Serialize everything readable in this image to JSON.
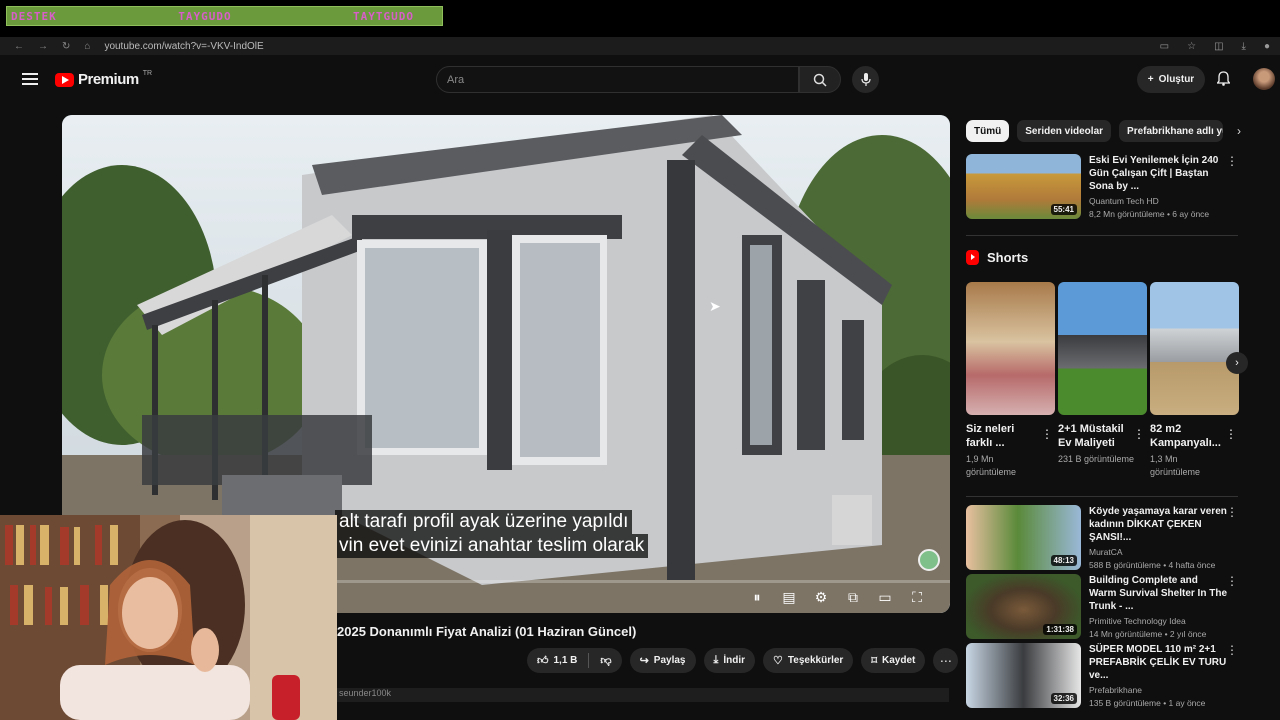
{
  "stream_overlay": {
    "left": "DESTEK",
    "middle": "TAYGUDO",
    "right": "TAYTGUDO"
  },
  "browser": {
    "url": "youtube.com/watch?v=-VKV-IndOlE"
  },
  "masthead": {
    "logo_text": "Premium",
    "logo_region": "TR",
    "search_placeholder": "Ara",
    "create_label": "Oluştur"
  },
  "player": {
    "subtitle_line1": "alt tarafı profil ayak üzerine yapıldı",
    "subtitle_line2": "vin evet evinizi anahtar teslim olarak",
    "progress": 0.0
  },
  "video": {
    "title": "2025 Donanımlı Fiyat Analizi (01 Haziran Güncel)",
    "like_count": "1,1 B",
    "share_label": "Paylaş",
    "download_label": "İndir",
    "thanks_label": "Teşekkürler",
    "save_label": "Kaydet",
    "description_fragment": "seunder100k"
  },
  "chips": [
    "Tümü",
    "Seriden videolar",
    "Prefabrikhane adlı yü"
  ],
  "recommendations_top": [
    {
      "title": "Eski Evi Yenilemek İçin 240 Gün Çalışan Çift | Baştan Sona by ...",
      "channel": "Quantum Tech HD",
      "stats": "8,2 Mn görüntüleme • 6 ay önce",
      "duration": "55:41"
    }
  ],
  "shorts": {
    "heading": "Shorts",
    "items": [
      {
        "title": "Siz neleri farklı ...",
        "views": "1,9 Mn görüntüleme"
      },
      {
        "title": "2+1 Müstakil Ev Maliyeti",
        "views": "231 B görüntüleme"
      },
      {
        "title": "82 m2 Kampanyalı...",
        "views": "1,3 Mn görüntüleme"
      }
    ]
  },
  "recommendations": [
    {
      "title": "Köyde yaşamaya karar veren kadının DİKKAT ÇEKEN ŞANSI!...",
      "channel": "MuratCA",
      "stats": "588 B görüntüleme • 4 hafta önce",
      "duration": "48:13"
    },
    {
      "title": "Building Complete and Warm Survival Shelter In The Trunk - ...",
      "channel": "Primitive Technology Idea",
      "stats": "14 Mn görüntüleme • 2 yıl önce",
      "duration": "1:31:38"
    },
    {
      "title": "SÜPER MODEL 110 m² 2+1 PREFABRİK ÇELİK EV TURU ve...",
      "channel": "Prefabrikhane",
      "stats": "135 B görüntüleme • 1 ay önce",
      "duration": "32:36"
    }
  ],
  "colors": {
    "background": "#0f0f0f",
    "brand_red": "#ff0000",
    "chip_bg": "#272727"
  }
}
